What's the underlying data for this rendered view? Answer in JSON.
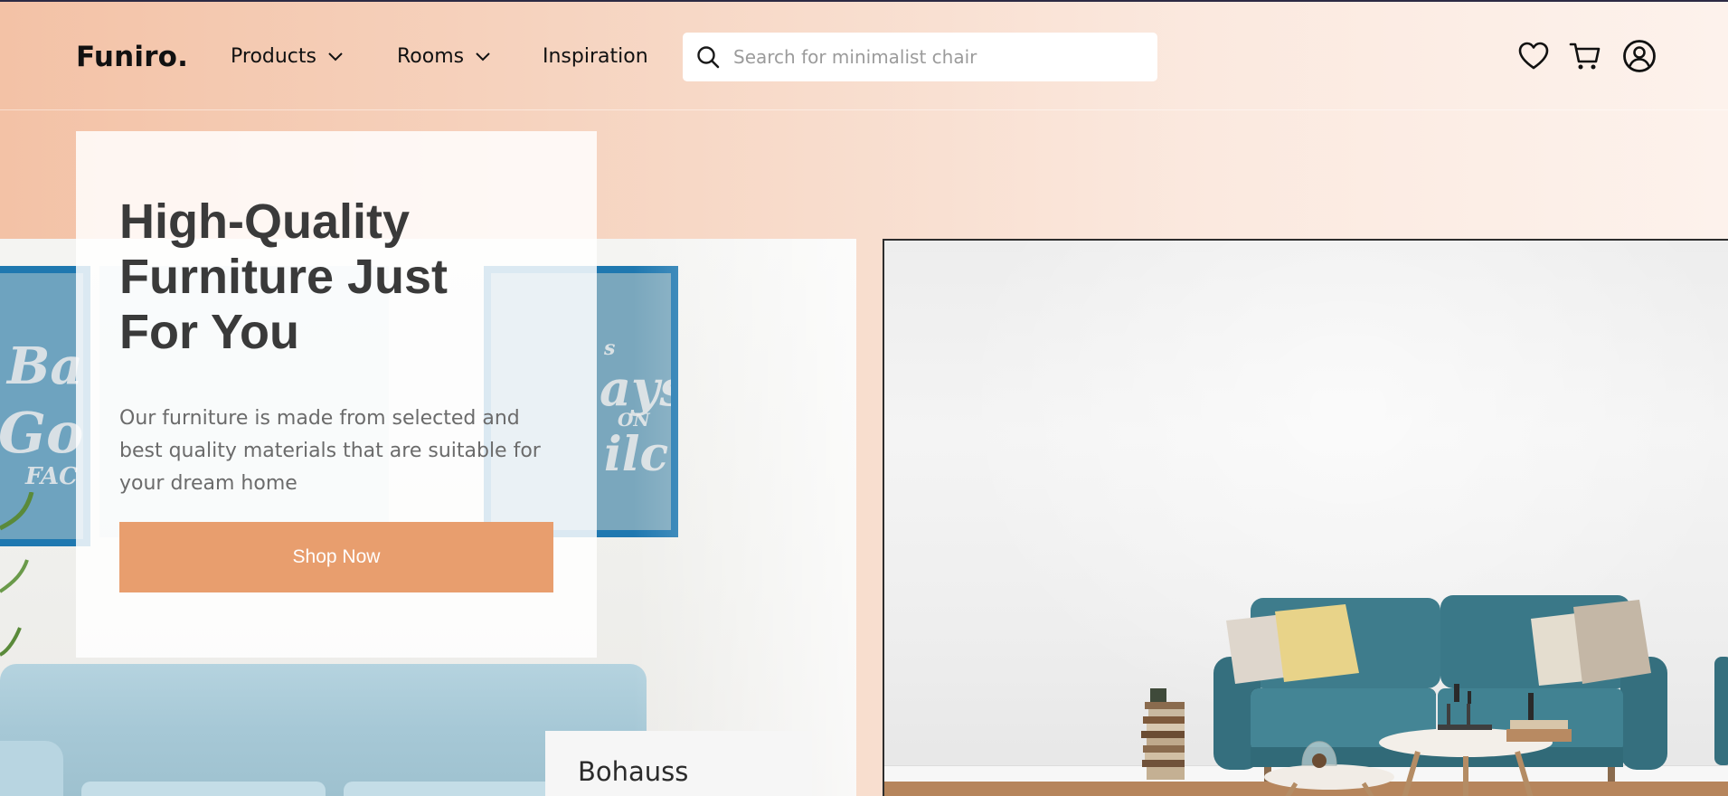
{
  "brand": {
    "logo": "Funiro."
  },
  "nav": {
    "products": "Products",
    "rooms": "Rooms",
    "inspiration": "Inspiration"
  },
  "search": {
    "placeholder": "Search for minimalist chair"
  },
  "icons": {
    "search": "search-icon",
    "wishlist": "heart-icon",
    "cart": "cart-icon",
    "account": "user-circle-icon",
    "dropdown": "chevron-down-icon"
  },
  "hero": {
    "title_line1": "High-Quality",
    "title_line2": "Furniture Just",
    "title_line3": "For You",
    "description": "Our furniture is made from selected and best quality materials that are suitable for your dream home",
    "cta": "Shop Now"
  },
  "featured": {
    "name": "Bohauss"
  },
  "colors": {
    "accent": "#e89e6e",
    "header_gradient_start": "#f3c2a6",
    "header_gradient_end": "#fdf2ec",
    "title_text": "#3a3a3a",
    "sofa_teal": "#3e7c8c"
  }
}
